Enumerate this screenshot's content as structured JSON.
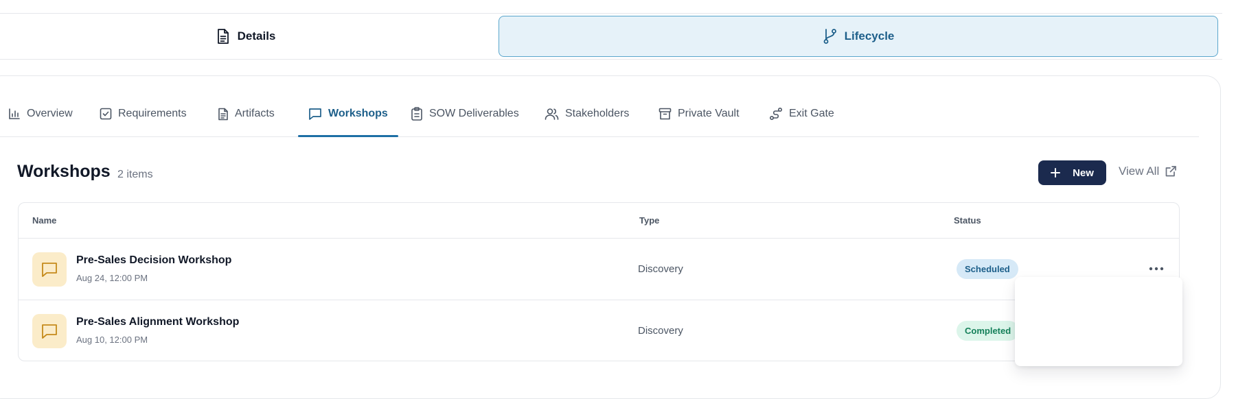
{
  "mode_tabs": [
    {
      "label": "Details",
      "icon": "document-icon",
      "active": false
    },
    {
      "label": "Lifecycle",
      "icon": "git-branch-icon",
      "active": true
    }
  ],
  "sub_tabs": [
    {
      "label": "Overview",
      "icon": "bar-chart-icon"
    },
    {
      "label": "Requirements",
      "icon": "checkbox-icon"
    },
    {
      "label": "Artifacts",
      "icon": "document-icon"
    },
    {
      "label": "Workshops",
      "icon": "chat-icon",
      "active": true
    },
    {
      "label": "SOW Deliverables",
      "icon": "clipboard-icon"
    },
    {
      "label": "Stakeholders",
      "icon": "users-icon"
    },
    {
      "label": "Private Vault",
      "icon": "archive-icon"
    },
    {
      "label": "Exit Gate",
      "icon": "route-icon"
    }
  ],
  "section": {
    "title": "Workshops",
    "count": "2 items",
    "new_label": "New",
    "view_all_label": "View All"
  },
  "table": {
    "columns": [
      "Name",
      "Type",
      "Status"
    ],
    "rows": [
      {
        "name": "Pre-Sales Decision Workshop",
        "date": "Aug 24, 12:00 PM",
        "type": "Discovery",
        "status": "Scheduled"
      },
      {
        "name": "Pre-Sales Alignment Workshop",
        "date": "Aug 10, 12:00 PM",
        "type": "Discovery",
        "status": "Completed"
      }
    ]
  },
  "colors": {
    "accent": "#1d6fa5",
    "primary_button": "#1b2a4e",
    "scheduled_badge": "#d6e9f7",
    "completed_badge": "#dcf5ea",
    "row_icon_bg": "#fbecc9"
  }
}
